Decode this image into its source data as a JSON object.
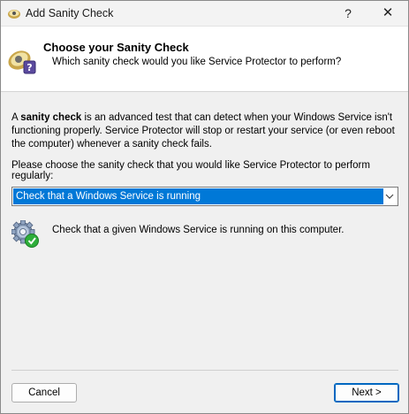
{
  "window": {
    "title": "Add Sanity Check",
    "help_glyph": "?",
    "close_glyph": "✕"
  },
  "header": {
    "title": "Choose your Sanity Check",
    "subtitle": "Which sanity check would you like Service Protector to perform?",
    "icon": "sanity-check-wizard-icon"
  },
  "content": {
    "description_prefix": "A ",
    "description_term": "sanity check",
    "description_rest": " is an advanced test that can detect when your Windows Service isn't functioning properly. Service Protector will stop or restart your service (or even reboot the computer) whenever a sanity check fails.",
    "prompt": "Please choose the sanity check that you would like Service Protector to perform regularly:",
    "select_value": "Check that a Windows Service is running",
    "check_description": "Check that a given Windows Service is running on this computer.",
    "check_icon": "gear-check-icon"
  },
  "buttons": {
    "cancel": "Cancel",
    "next": "Next >"
  },
  "colors": {
    "selection": "#0078d7",
    "window_bg": "#f0f0f0",
    "header_bg": "#ffffff",
    "primary_border": "#0067c0"
  }
}
